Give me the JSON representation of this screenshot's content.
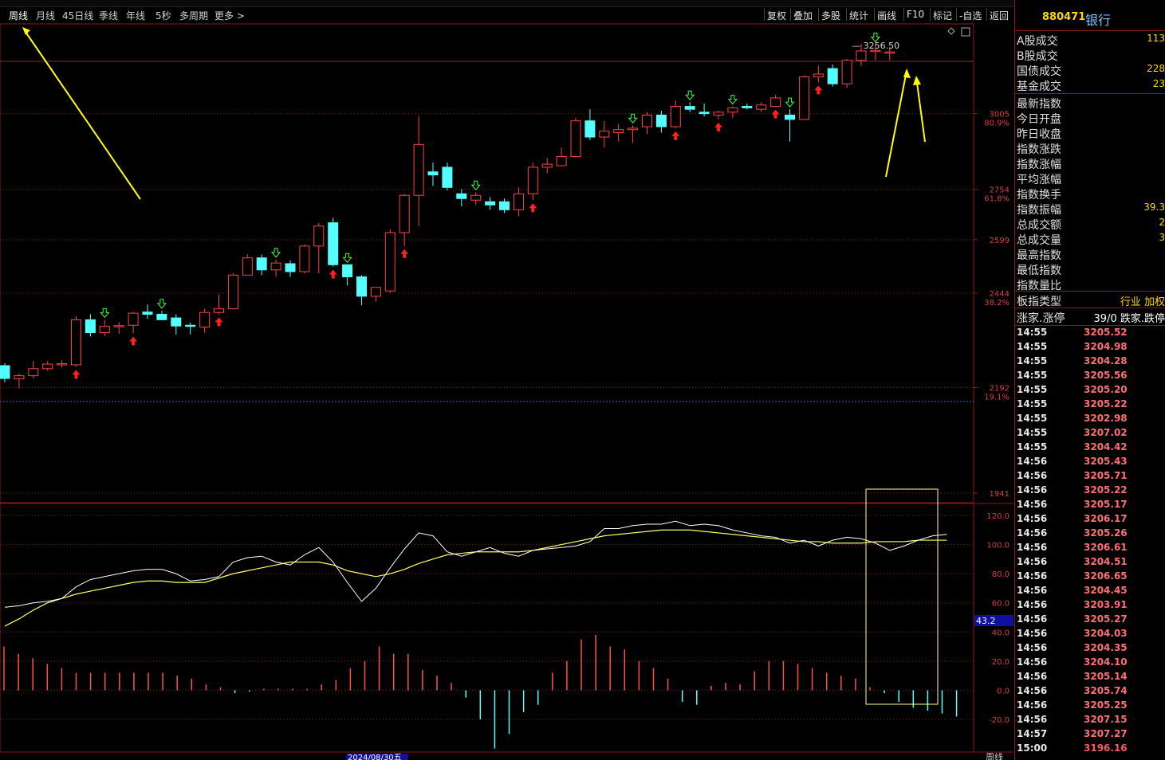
{
  "toolbar": {
    "periods": [
      "周线",
      "月线",
      "45日线",
      "季线",
      "年线",
      "5秒",
      "多周期",
      "更多 >"
    ],
    "tools": [
      "复权",
      "叠加",
      "多股",
      "统计",
      "画线",
      "F10",
      "标记",
      "-自选",
      "返回"
    ]
  },
  "security": {
    "code": "880471",
    "name": "银行"
  },
  "stats": [
    {
      "label": "A股成交",
      "value": "113"
    },
    {
      "label": "B股成交",
      "value": ""
    },
    {
      "label": "国债成交",
      "value": "228"
    },
    {
      "label": "基金成交",
      "value": "23"
    },
    {
      "label": "最新指数",
      "value": ""
    },
    {
      "label": "今日开盘",
      "value": ""
    },
    {
      "label": "昨日收盘",
      "value": ""
    },
    {
      "label": "指数涨跌",
      "value": ""
    },
    {
      "label": "指数涨幅",
      "value": ""
    },
    {
      "label": "平均涨幅",
      "value": ""
    },
    {
      "label": "指数换手",
      "value": ""
    },
    {
      "label": "指数振幅",
      "value": "39.3"
    },
    {
      "label": "总成交额",
      "value": "2"
    },
    {
      "label": "总成交量",
      "value": "3"
    },
    {
      "label": "最高指数",
      "value": ""
    },
    {
      "label": "最低指数",
      "value": ""
    },
    {
      "label": "指数量比",
      "value": ""
    },
    {
      "label": "板指类型",
      "value": "行业 加权"
    },
    {
      "label": "涨家.涨停",
      "value": "39/0 跌家.跌停"
    }
  ],
  "ticks": [
    {
      "time": "14:55",
      "price": "3205.52"
    },
    {
      "time": "14:55",
      "price": "3204.98"
    },
    {
      "time": "14:55",
      "price": "3204.28"
    },
    {
      "time": "14:55",
      "price": "3205.56"
    },
    {
      "time": "14:55",
      "price": "3205.20"
    },
    {
      "time": "14:55",
      "price": "3205.22"
    },
    {
      "time": "14:55",
      "price": "3202.98"
    },
    {
      "time": "14:55",
      "price": "3207.02"
    },
    {
      "time": "14:55",
      "price": "3204.42"
    },
    {
      "time": "14:56",
      "price": "3205.43"
    },
    {
      "time": "14:56",
      "price": "3205.71"
    },
    {
      "time": "14:56",
      "price": "3205.22"
    },
    {
      "time": "14:56",
      "price": "3205.17"
    },
    {
      "time": "14:56",
      "price": "3206.17"
    },
    {
      "time": "14:56",
      "price": "3205.26"
    },
    {
      "time": "14:56",
      "price": "3206.61"
    },
    {
      "time": "14:56",
      "price": "3204.51"
    },
    {
      "time": "14:56",
      "price": "3206.65"
    },
    {
      "time": "14:56",
      "price": "3204.45"
    },
    {
      "time": "14:56",
      "price": "3203.91"
    },
    {
      "time": "14:56",
      "price": "3205.27"
    },
    {
      "time": "14:56",
      "price": "3204.03"
    },
    {
      "time": "14:56",
      "price": "3204.35"
    },
    {
      "time": "14:56",
      "price": "3204.10"
    },
    {
      "time": "14:56",
      "price": "3205.14"
    },
    {
      "time": "14:56",
      "price": "3205.74"
    },
    {
      "time": "14:56",
      "price": "3205.25"
    },
    {
      "time": "14:56",
      "price": "3207.15"
    },
    {
      "time": "14:57",
      "price": "3207.27"
    },
    {
      "time": "15:00",
      "price": "3196.16"
    }
  ],
  "colors": {
    "up": "#ff4444",
    "down": "#54ffff",
    "ma": "#ffff66",
    "osc": "#ffffff",
    "grid": "#8a1a1a",
    "arrow": "#ffff00"
  },
  "chart_data": {
    "type": "candlestick",
    "period": "周线",
    "price_axis": {
      "ticks": [
        3256.5,
        3005,
        2754,
        2599,
        2444,
        2192,
        1941
      ],
      "tick_labels": [
        "3256.50",
        "3005",
        "2754",
        "2599",
        "2444",
        "2192",
        "1941"
      ],
      "pct_labels": [
        {
          "price": 3005,
          "label": "80.9%"
        },
        {
          "price": 2754,
          "label": "61.8%"
        },
        {
          "price": 2444,
          "label": "38.2%"
        },
        {
          "price": 2192,
          "label": "19.1%"
        }
      ],
      "max_label": "3256.50"
    },
    "candles": [
      {
        "o": 2248,
        "h": 2254,
        "l": 2205,
        "c": 2215
      },
      {
        "o": 2214,
        "h": 2228,
        "l": 2190,
        "c": 2222
      },
      {
        "o": 2222,
        "h": 2260,
        "l": 2215,
        "c": 2240
      },
      {
        "o": 2240,
        "h": 2260,
        "l": 2235,
        "c": 2252
      },
      {
        "o": 2252,
        "h": 2262,
        "l": 2244,
        "c": 2253
      },
      {
        "o": 2250,
        "h": 2380,
        "l": 2245,
        "c": 2370
      },
      {
        "o": 2370,
        "h": 2385,
        "l": 2325,
        "c": 2335
      },
      {
        "o": 2335,
        "h": 2370,
        "l": 2325,
        "c": 2352
      },
      {
        "o": 2353,
        "h": 2363,
        "l": 2332,
        "c": 2354
      },
      {
        "o": 2355,
        "h": 2392,
        "l": 2333,
        "c": 2388
      },
      {
        "o": 2391,
        "h": 2412,
        "l": 2372,
        "c": 2385
      },
      {
        "o": 2385,
        "h": 2395,
        "l": 2372,
        "c": 2370
      },
      {
        "o": 2375,
        "h": 2385,
        "l": 2330,
        "c": 2353
      },
      {
        "o": 2355,
        "h": 2362,
        "l": 2330,
        "c": 2352
      },
      {
        "o": 2350,
        "h": 2400,
        "l": 2335,
        "c": 2390
      },
      {
        "o": 2390,
        "h": 2440,
        "l": 2385,
        "c": 2400
      },
      {
        "o": 2400,
        "h": 2500,
        "l": 2398,
        "c": 2495
      },
      {
        "o": 2495,
        "h": 2555,
        "l": 2495,
        "c": 2545
      },
      {
        "o": 2545,
        "h": 2555,
        "l": 2495,
        "c": 2510
      },
      {
        "o": 2510,
        "h": 2540,
        "l": 2490,
        "c": 2530
      },
      {
        "o": 2528,
        "h": 2538,
        "l": 2490,
        "c": 2505
      },
      {
        "o": 2505,
        "h": 2585,
        "l": 2500,
        "c": 2580
      },
      {
        "o": 2580,
        "h": 2650,
        "l": 2500,
        "c": 2640
      },
      {
        "o": 2650,
        "h": 2665,
        "l": 2520,
        "c": 2525
      },
      {
        "o": 2525,
        "h": 2525,
        "l": 2465,
        "c": 2490
      },
      {
        "o": 2490,
        "h": 2495,
        "l": 2410,
        "c": 2435
      },
      {
        "o": 2435,
        "h": 2460,
        "l": 2420,
        "c": 2460
      },
      {
        "o": 2450,
        "h": 2630,
        "l": 2445,
        "c": 2620
      },
      {
        "o": 2620,
        "h": 2740,
        "l": 2580,
        "c": 2735
      },
      {
        "o": 2735,
        "h": 2995,
        "l": 2640,
        "c": 2900
      },
      {
        "o": 2810,
        "h": 2840,
        "l": 2765,
        "c": 2800
      },
      {
        "o": 2825,
        "h": 2840,
        "l": 2750,
        "c": 2760
      },
      {
        "o": 2740,
        "h": 2755,
        "l": 2700,
        "c": 2725
      },
      {
        "o": 2720,
        "h": 2745,
        "l": 2705,
        "c": 2735
      },
      {
        "o": 2715,
        "h": 2730,
        "l": 2690,
        "c": 2705
      },
      {
        "o": 2715,
        "h": 2725,
        "l": 2680,
        "c": 2690
      },
      {
        "o": 2690,
        "h": 2760,
        "l": 2670,
        "c": 2740
      },
      {
        "o": 2740,
        "h": 2840,
        "l": 2720,
        "c": 2825
      },
      {
        "o": 2825,
        "h": 2855,
        "l": 2805,
        "c": 2835
      },
      {
        "o": 2830,
        "h": 2890,
        "l": 2830,
        "c": 2860
      },
      {
        "o": 2860,
        "h": 2990,
        "l": 2860,
        "c": 2980
      },
      {
        "o": 2980,
        "h": 3020,
        "l": 2915,
        "c": 2925
      },
      {
        "o": 2925,
        "h": 2980,
        "l": 2890,
        "c": 2945
      },
      {
        "o": 2940,
        "h": 2970,
        "l": 2910,
        "c": 2950
      },
      {
        "o": 2950,
        "h": 2965,
        "l": 2905,
        "c": 2955
      },
      {
        "o": 2960,
        "h": 3010,
        "l": 2935,
        "c": 3000
      },
      {
        "o": 3000,
        "h": 3015,
        "l": 2940,
        "c": 2960
      },
      {
        "o": 2960,
        "h": 3050,
        "l": 2955,
        "c": 3030
      },
      {
        "o": 3030,
        "h": 3045,
        "l": 3010,
        "c": 3020
      },
      {
        "o": 3010,
        "h": 3040,
        "l": 2995,
        "c": 3005
      },
      {
        "o": 3000,
        "h": 3015,
        "l": 2985,
        "c": 3010
      },
      {
        "o": 3010,
        "h": 3030,
        "l": 2990,
        "c": 3025
      },
      {
        "o": 3030,
        "h": 3040,
        "l": 3020,
        "c": 3025
      },
      {
        "o": 3020,
        "h": 3045,
        "l": 3010,
        "c": 3035
      },
      {
        "o": 3030,
        "h": 3070,
        "l": 3030,
        "c": 3060
      },
      {
        "o": 3000,
        "h": 3020,
        "l": 2910,
        "c": 2985
      },
      {
        "o": 2985,
        "h": 3140,
        "l": 2985,
        "c": 3135
      },
      {
        "o": 3135,
        "h": 3175,
        "l": 3115,
        "c": 3145
      },
      {
        "o": 3165,
        "h": 3180,
        "l": 3100,
        "c": 3110
      },
      {
        "o": 3110,
        "h": 3200,
        "l": 3095,
        "c": 3195
      },
      {
        "o": 3195,
        "h": 3256,
        "l": 3175,
        "c": 3230
      },
      {
        "o": 3230,
        "h": 3255,
        "l": 3195,
        "c": 3232
      },
      {
        "o": 3225,
        "h": 3245,
        "l": 3195,
        "c": 3226
      }
    ],
    "sell_signals": [
      7,
      11,
      24,
      19,
      33,
      44,
      48,
      51,
      55,
      61
    ],
    "buy_signals": [
      5,
      9,
      15,
      23,
      28,
      37,
      47,
      50,
      54,
      57
    ],
    "oscillator": {
      "axis_ticks": [
        120.0,
        100.0,
        80.0,
        60.0,
        40.0,
        20.0,
        0.0,
        -20.0
      ],
      "current_label": "43.2",
      "line": [
        57,
        58,
        60,
        61,
        63,
        71,
        76,
        78,
        80,
        82,
        83,
        83,
        80,
        75,
        76,
        78,
        88,
        91,
        92,
        88,
        86,
        93,
        98,
        88,
        74,
        61,
        70,
        84,
        97,
        108,
        106,
        95,
        92,
        95,
        98,
        94,
        92,
        96,
        97,
        98,
        99,
        102,
        111,
        111,
        113,
        114,
        114,
        116,
        113,
        114,
        113,
        110,
        108,
        106,
        105,
        101,
        103,
        99,
        103,
        105,
        104,
        101,
        96,
        99,
        103,
        106,
        107
      ],
      "signal": [
        44,
        49,
        55,
        60,
        63,
        66,
        68,
        70,
        72,
        74,
        75,
        75,
        74,
        74,
        74,
        77,
        80,
        82,
        84,
        86,
        88,
        88,
        88,
        86,
        82,
        80,
        78,
        80,
        83,
        87,
        90,
        93,
        94,
        95,
        95,
        95,
        95,
        96,
        98,
        100,
        102,
        104,
        106,
        107,
        108,
        109,
        110,
        110,
        110,
        109,
        108,
        107,
        106,
        105,
        104,
        103,
        102,
        102,
        101,
        101,
        101,
        102,
        102,
        102,
        103,
        103,
        103
      ],
      "histogram": [
        30,
        25,
        22,
        18,
        15,
        12,
        12,
        12,
        12,
        12,
        12,
        12,
        10,
        8,
        4,
        2,
        -2,
        -1,
        1,
        1,
        1,
        1,
        4,
        7,
        15,
        20,
        30,
        25,
        25,
        14,
        10,
        5,
        -5,
        -20,
        -40,
        -30,
        -15,
        -10,
        12,
        20,
        35,
        38,
        30,
        28,
        20,
        15,
        8,
        -8,
        -10,
        3,
        5,
        4,
        13,
        20,
        20,
        18,
        15,
        12,
        10,
        8,
        2,
        -2,
        -8,
        -12,
        -14,
        -16,
        -18,
        -20,
        -18,
        -12,
        -10,
        -5,
        6,
        8,
        7
      ],
      "hist_note": ""
    },
    "x_axis": {
      "highlight_label": "2024/08/30五",
      "right_label": "周线"
    }
  }
}
